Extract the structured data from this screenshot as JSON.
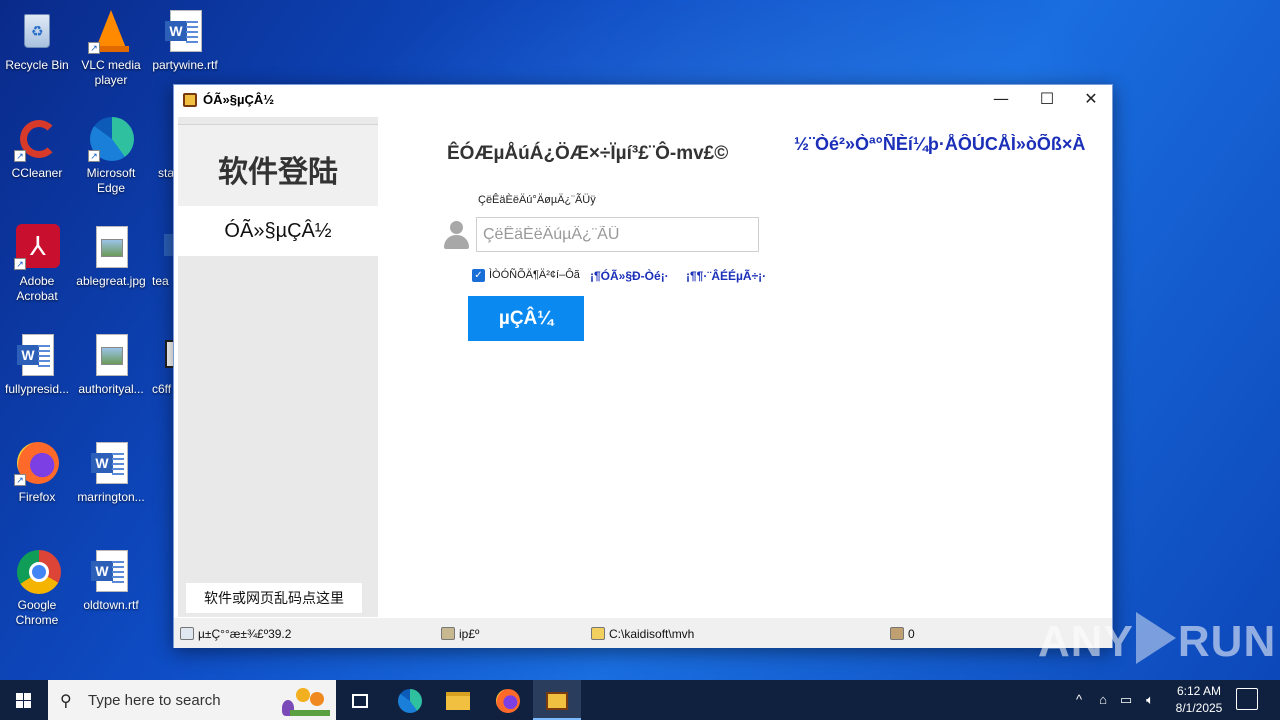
{
  "desktop": {
    "icons": [
      {
        "label": "Recycle Bin"
      },
      {
        "label": "VLC media player"
      },
      {
        "label": "partywine.rtf"
      },
      {
        "label": "CCleaner"
      },
      {
        "label": "Microsoft Edge"
      },
      {
        "label": "sta"
      },
      {
        "label": "Adobe Acrobat"
      },
      {
        "label": "ablegreat.jpg"
      },
      {
        "label": "tea"
      },
      {
        "label": "fullypresid..."
      },
      {
        "label": "authorityal..."
      },
      {
        "label": "c6ff"
      },
      {
        "label": "Firefox"
      },
      {
        "label": "marrington..."
      },
      {
        "label": "Google Chrome"
      },
      {
        "label": "oldtown.rtf"
      }
    ]
  },
  "window": {
    "title": "ÓÃ»§µÇÂ½",
    "controls": {
      "minimize": "—",
      "maximize": "☐",
      "close": "✕"
    },
    "sidebar": {
      "title": "软件登陆",
      "nav_item": "ÓÃ»§µÇÂ½",
      "footer_button": "软件或网页乱码点这里"
    },
    "main": {
      "title": "ÊÓÆµÅúÁ¿ÖÆ×÷Ïµí³£¨Ô-mv£©",
      "marquee": "½¨Òé²»Òª°ÑÈí¼þ·ÅÔÚCÅÌ»òÕß×À",
      "field_label": "ÇëÊäÈëÄú°ÄøµÄ¿¨ÃÜÿ",
      "input_placeholder": "ÇëÊäÈëÄúµÄ¿¨ÃÜ",
      "remember_label": "ÌÒÓÑÕÄ¶Ä²¢í–Ôã",
      "link_register": "¡¶ÓÃ»§Ð-Òé¡·",
      "link_buy": "¡¶¶·¨ÂÉÉµÃ÷¡·",
      "login_button": "µÇÂ¼"
    },
    "statusbar": {
      "version": "µ±Ç°°æ±¾£º39.2",
      "ip": "ip£º",
      "path": "C:\\kaidisoft\\mvh",
      "count": "0"
    }
  },
  "watermark": {
    "left": "ANY",
    "right": "RUN"
  },
  "taskbar": {
    "search_placeholder": "Type here to search",
    "time": "6:12 AM",
    "date": "8/1/2025"
  }
}
